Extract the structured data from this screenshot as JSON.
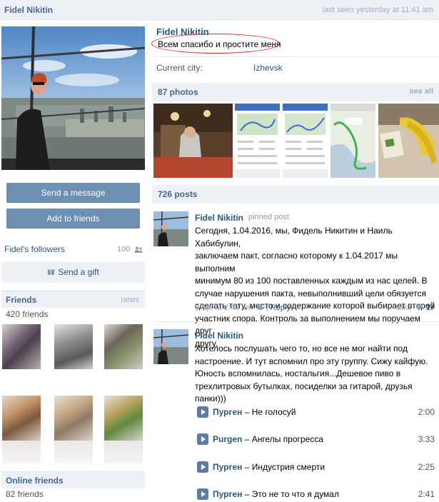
{
  "header": {
    "name": "Fidel Nikitin",
    "last_seen": "last seen yesterday at 11:41 am"
  },
  "left": {
    "send_message": "Send a message",
    "add_friends": "Add to friends",
    "followers_label": "Fidel's followers",
    "followers_count": "100",
    "gift_label": "Send a gift",
    "friends_title": "Friends",
    "friends_news": "news",
    "friends_count": "420 friends",
    "online_title": "Online friends",
    "online_count": "82 friends"
  },
  "profile": {
    "name": "Fidel Nikitin",
    "status": "Всем спасибо и простите меня",
    "city_label": "Current city:",
    "city_value": "Izhevsk"
  },
  "photos": {
    "title": "87 photos",
    "see_all": "see all"
  },
  "posts": {
    "title": "726 posts",
    "items": [
      {
        "author": "Fidel Nikitin",
        "pinned": "pinned post",
        "lines": [
          "Сегодня, 1.04.2016, мы, Фидель Никитин и Наиль Хабибулин,",
          "заключаем пакт, согласно которому к 1.04.2017 мы выполним",
          "минимум 80 из 100 поставленных каждым из нас целей. В",
          "случае нарушения пакта, невыполнивший цели обязуется",
          "сделать тату, место и содержание которой выбирает второй",
          "участник спора. Контроль за выполнением мы поручаем друг",
          "другу."
        ],
        "date": "2 Apr at 2:48 am",
        "reply": "Reply",
        "like_label": "Like",
        "like_count": "17"
      },
      {
        "author": "Fidel Nikitin",
        "lines": [
          "Хотелось послушать чего то, но все не мог найти под",
          "настроение. И тут вспомнил про эту группу. Сижу кайфую.",
          "Юность вспомнилась, ностальгия...Дешевое пиво в",
          "трехлитровых бутылках, посиделки за гитарой, друзья",
          "панки)))"
        ]
      }
    ]
  },
  "tracks": [
    {
      "artist": "Пурген",
      "title": "Не голосуй",
      "duration": "2:00"
    },
    {
      "artist": "Purgen",
      "title": "Ангелы прогресса",
      "duration": "3:33"
    },
    {
      "artist": "Пурген",
      "title": "Индустрия смерти",
      "duration": "2:25"
    },
    {
      "artist": "Пурген",
      "title": "Это не то что я думал",
      "duration": "2:41"
    }
  ],
  "colors": {
    "accent": "#45688e",
    "link": "#2b587a",
    "button": "#6d8fb3",
    "section_bg": "#edf0f5",
    "status_ring": "#d62a2a"
  },
  "icons": [
    "people-icon",
    "gift-icon",
    "camera-icon",
    "heart-icon",
    "play-icon"
  ]
}
